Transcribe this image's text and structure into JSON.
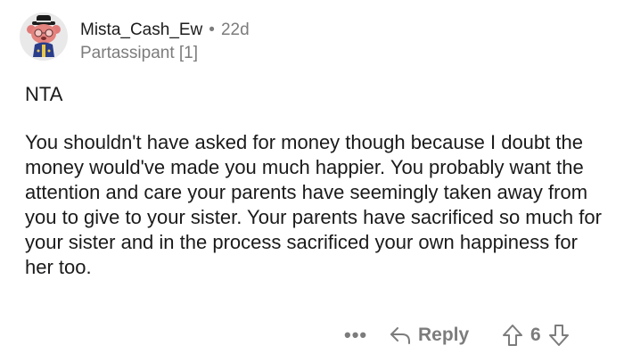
{
  "comment": {
    "author": {
      "username": "Mista_Cash_Ew",
      "separator": "•",
      "age": "22d",
      "flair": "Partassipant [1]",
      "avatar_icon": "snoo-avatar-icon"
    },
    "verdict": "NTA",
    "body": "You shouldn't have asked for money though because I doubt the money would've made you much happier. You probably want the attention and care your parents have seemingly taken away from you to give to your sister. Your parents have sacrificed so much for your sister and in the process sacrificed your own happiness for her too.",
    "actions": {
      "more_label": "•••",
      "reply_label": "Reply",
      "score": "6"
    }
  },
  "colors": {
    "text": "#1a1a1b",
    "muted": "#7c7c7c",
    "avatar_bg": "#e9e9ea"
  }
}
